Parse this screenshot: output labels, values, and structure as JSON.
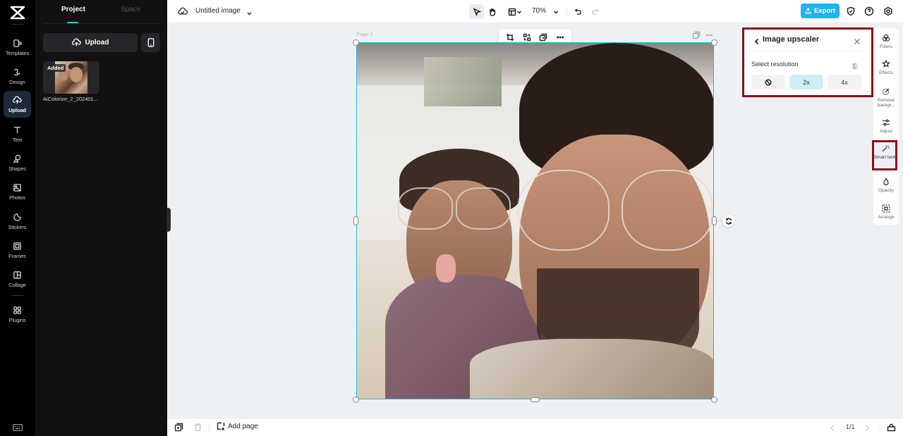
{
  "app": {
    "brand": "CapCut"
  },
  "rail": {
    "items": [
      {
        "label": "Templates",
        "icon": "templates-icon"
      },
      {
        "label": "Design",
        "icon": "design-icon"
      },
      {
        "label": "Upload",
        "icon": "upload-cloud-icon",
        "active": true
      },
      {
        "label": "Text",
        "icon": "text-icon"
      },
      {
        "label": "Shapes",
        "icon": "shapes-icon"
      },
      {
        "label": "Photos",
        "icon": "photos-icon"
      },
      {
        "label": "Stickers",
        "icon": "stickers-icon"
      },
      {
        "label": "Frames",
        "icon": "frames-icon"
      },
      {
        "label": "Collage",
        "icon": "collage-icon"
      },
      {
        "label": "Plugins",
        "icon": "plugins-icon"
      }
    ]
  },
  "panel": {
    "tabs": [
      {
        "label": "Project",
        "active": true
      },
      {
        "label": "Space",
        "active": false
      }
    ],
    "upload_label": "Upload",
    "assets": [
      {
        "badge": "Added",
        "name": "AiColorize_2_202401..."
      }
    ]
  },
  "topbar": {
    "doc_title": "Untitled image",
    "zoom": "70%",
    "export_label": "Export",
    "accent_color": "#1fb4ea"
  },
  "canvas": {
    "page_label": "Page 1"
  },
  "upscaler": {
    "title": "Image upscaler",
    "subtitle": "Select resolution",
    "options": [
      {
        "label": "",
        "icon": "none-icon",
        "selected": false
      },
      {
        "label": "2x",
        "selected": true
      },
      {
        "label": "4x",
        "selected": false
      }
    ]
  },
  "right_tools": [
    {
      "label": "Filters"
    },
    {
      "label": "Effects"
    },
    {
      "label": "Remove backgr..."
    },
    {
      "label": "Adjust"
    },
    {
      "label": "Smart tools",
      "highlighted": true
    },
    {
      "label": "Opacity"
    },
    {
      "label": "Arrange"
    }
  ],
  "bottombar": {
    "add_page_label": "Add page",
    "page_indicator": "1/1"
  }
}
